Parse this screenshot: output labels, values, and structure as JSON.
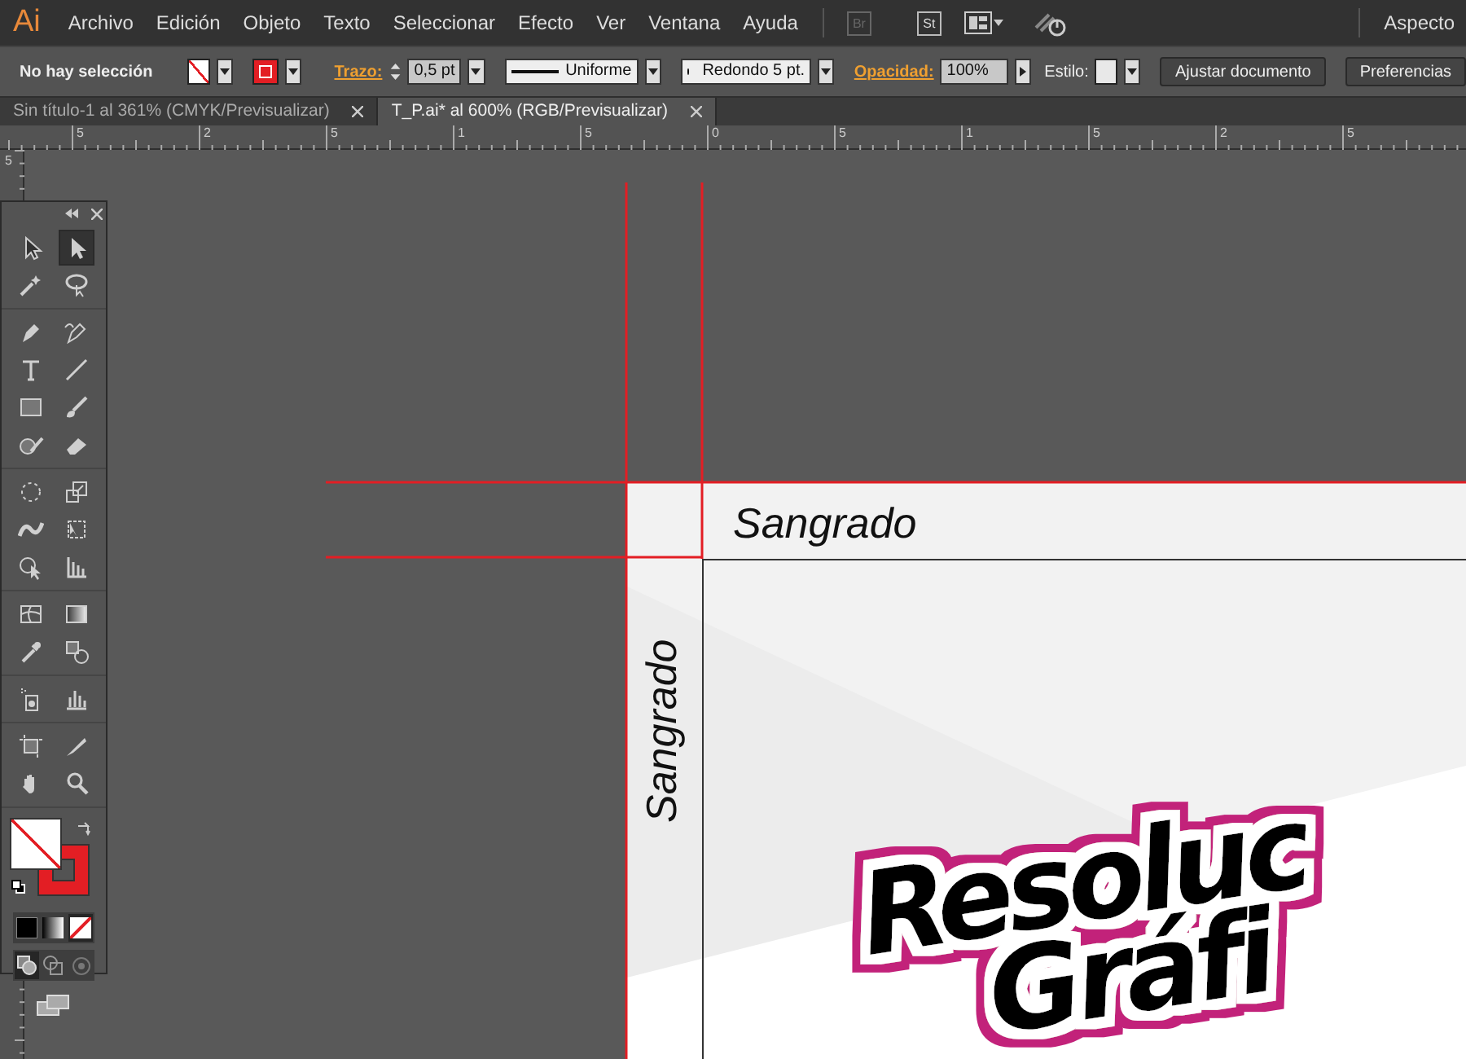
{
  "menu_bar": {
    "app_logo": "Ai",
    "menus": [
      "Archivo",
      "Edición",
      "Objeto",
      "Texto",
      "Seleccionar",
      "Efecto",
      "Ver",
      "Ventana",
      "Ayuda"
    ],
    "app_buttons": [
      {
        "label": "Br",
        "disabled": true
      },
      {
        "label": "St",
        "disabled": false
      }
    ],
    "workspace": "Aspecto"
  },
  "control_bar": {
    "selection_label": "No hay selección",
    "stroke_label": "Trazo:",
    "stroke_weight": "0,5 pt",
    "profile": "Uniforme",
    "brush": "Redondo 5 pt.",
    "opacity_label": "Opacidad:",
    "opacity": "100%",
    "style_label": "Estilo:",
    "buttons": [
      "Ajustar documento",
      "Preferencias"
    ]
  },
  "tabs": [
    {
      "label": "Sin título-1 al 361% (CMYK/Previsualizar)",
      "selected": false
    },
    {
      "label": "T_P.ai* al 600% (RGB/Previsualizar)",
      "selected": true
    }
  ],
  "ruler": {
    "labels": [
      "5",
      "2",
      "5",
      "1",
      "5",
      "0",
      "5",
      "1",
      "5",
      "2",
      "5"
    ],
    "vertical_labels": [
      "5"
    ]
  },
  "artboard": {
    "bleed_labels": [
      "Sangrado",
      "Sangrado"
    ],
    "logo_lines": [
      "Resoluc",
      "Gráfi"
    ]
  },
  "toolbox": {
    "tool_groups": [
      [
        {
          "kind": "selection",
          "selected": false
        },
        {
          "kind": "direct-selection",
          "selected": true
        },
        {
          "kind": "magic-wand",
          "selected": false
        },
        {
          "kind": "lasso",
          "selected": false
        }
      ],
      [
        {
          "kind": "pen",
          "selected": false
        },
        {
          "kind": "curvature",
          "selected": false
        },
        {
          "kind": "type",
          "selected": false
        },
        {
          "kind": "line",
          "selected": false
        },
        {
          "kind": "rectangle",
          "selected": false
        },
        {
          "kind": "paintbrush",
          "selected": false
        },
        {
          "kind": "shaper",
          "selected": false
        },
        {
          "kind": "eraser",
          "selected": false
        }
      ],
      [
        {
          "kind": "rotate",
          "selected": false
        },
        {
          "kind": "scale",
          "selected": false
        },
        {
          "kind": "width",
          "selected": false
        },
        {
          "kind": "free-transform",
          "selected": false
        },
        {
          "kind": "shape-builder",
          "selected": false
        },
        {
          "kind": "graph-grid",
          "selected": false
        }
      ],
      [
        {
          "kind": "mesh",
          "selected": false
        },
        {
          "kind": "gradient",
          "selected": false
        },
        {
          "kind": "eyedropper",
          "selected": false
        },
        {
          "kind": "blend",
          "selected": false
        }
      ],
      [
        {
          "kind": "sprayer",
          "selected": false
        },
        {
          "kind": "column-graph",
          "selected": false
        }
      ],
      [
        {
          "kind": "artboard",
          "selected": false
        },
        {
          "kind": "slice",
          "selected": false
        },
        {
          "kind": "hand",
          "selected": false
        },
        {
          "kind": "zoom",
          "selected": false
        }
      ]
    ],
    "color_modes": [
      {
        "kind": "color",
        "selected": false
      },
      {
        "kind": "gradient",
        "selected": false
      },
      {
        "kind": "none",
        "selected": true
      }
    ],
    "draw_modes": [
      {
        "kind": "normal",
        "selected": true
      },
      {
        "kind": "behind",
        "selected": false
      },
      {
        "kind": "inside",
        "selected": false
      }
    ]
  }
}
